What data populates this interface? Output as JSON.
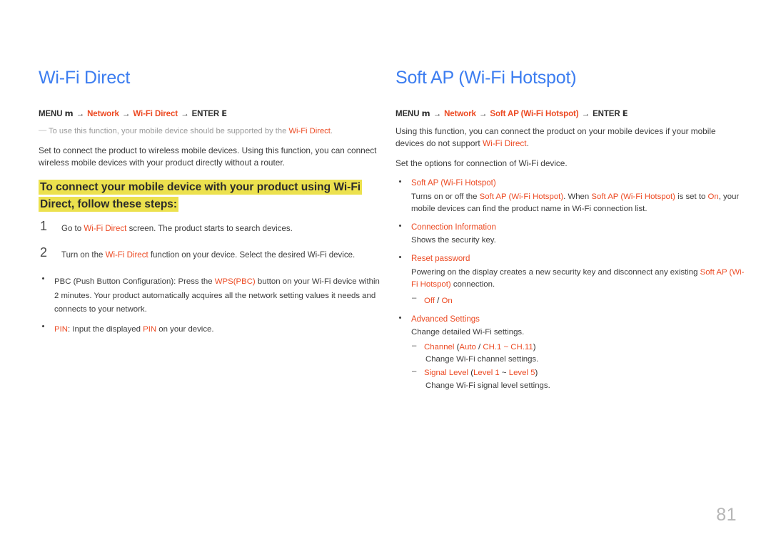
{
  "page": {
    "number": "81",
    "background_color": "#ffffff",
    "title_color": "#3c7df0",
    "accent_color": "#ec4a23",
    "highlight_color": "#ece14e",
    "body_color": "#3c3c3c",
    "note_color": "#9a9a9a"
  },
  "left": {
    "title": "Wi-Fi Direct",
    "menu_path": {
      "prefix": "MENU",
      "menu_glyph": "m",
      "arrow": "→",
      "item1": "Network",
      "item2": "Wi-Fi Direct",
      "suffix": "ENTER",
      "enter_glyph": "E"
    },
    "note": {
      "dash": "—",
      "text_before": "To use this function, your mobile device should be supported by the ",
      "accent": "Wi-Fi Direct",
      "text_after": "."
    },
    "paragraph": "Set to connect the product to wireless mobile devices. Using this function, you can connect wireless mobile devices with your product directly without a router.",
    "highlight_heading": "To connect your mobile device with your product using Wi-Fi Direct, follow these steps:",
    "steps": [
      {
        "number": "1",
        "before": "Go to ",
        "accent": "Wi-Fi Direct",
        "after": " screen. The product starts to search devices."
      },
      {
        "number": "2",
        "before": "Turn on the ",
        "accent": "Wi-Fi Direct",
        "after": " function on your device. Select the desired Wi-Fi device."
      }
    ],
    "bullets": [
      {
        "before": "PBC (Push Button Configuration): Press the ",
        "accent": "WPS(PBC)",
        "after": " button on your Wi-Fi device within 2 minutes. Your product automatically acquires all the network setting values it needs and connects to your network."
      },
      {
        "accent_lead": "PIN",
        "mid": ": Input the displayed ",
        "accent2": "PIN",
        "tail": " on your device."
      }
    ]
  },
  "right": {
    "title": "Soft AP (Wi-Fi Hotspot)",
    "menu_path": {
      "prefix": "MENU",
      "menu_glyph": "m",
      "arrow": "→",
      "item1": "Network",
      "item2": "Soft AP (Wi-Fi Hotspot)",
      "suffix": "ENTER",
      "enter_glyph": "E"
    },
    "paragraph1_before": "Using this function, you can connect the product on your mobile devices if your mobile devices do not support ",
    "paragraph1_accent": "Wi-Fi Direct",
    "paragraph1_after": ".",
    "paragraph2": "Set the options for connection of Wi-Fi device.",
    "options": [
      {
        "title": "Soft AP (Wi-Fi Hotspot)",
        "desc_p1": "Turns on or off the ",
        "desc_a1": "Soft AP (Wi-Fi Hotspot)",
        "desc_p2": ". When ",
        "desc_a2": "Soft AP (Wi-Fi Hotspot)",
        "desc_p3": " is set to ",
        "desc_a3": "On",
        "desc_p4": ", your mobile devices can find the product name in Wi-Fi connection list."
      },
      {
        "title": "Connection Information",
        "desc_p1": "Shows the security key."
      },
      {
        "title": "Reset password",
        "desc_p1": "Powering on the display creates a new security key and disconnect any existing ",
        "desc_a1": "Soft AP (Wi-Fi Hotspot)",
        "desc_p2": " connection.",
        "subitems": [
          {
            "dash": "–",
            "accent1": "Off",
            "sep": " / ",
            "accent2": "On"
          }
        ]
      },
      {
        "title": "Advanced Settings",
        "desc_p1": "Change detailed Wi-Fi settings.",
        "subitems": [
          {
            "dash": "–",
            "label_accent": "Channel",
            "paren_open": " (",
            "val1": "Auto",
            "val_sep": " / ",
            "val2": "CH.1 ~ CH.11",
            "paren_close": ")",
            "desc": "Change Wi-Fi channel settings."
          },
          {
            "dash": "–",
            "label_accent": "Signal Level",
            "paren_open": " (",
            "val1": "Level 1",
            "val_sep": " ~ ",
            "val2": "Level 5",
            "paren_close": ")",
            "desc": "Change Wi-Fi signal level settings."
          }
        ]
      }
    ]
  }
}
